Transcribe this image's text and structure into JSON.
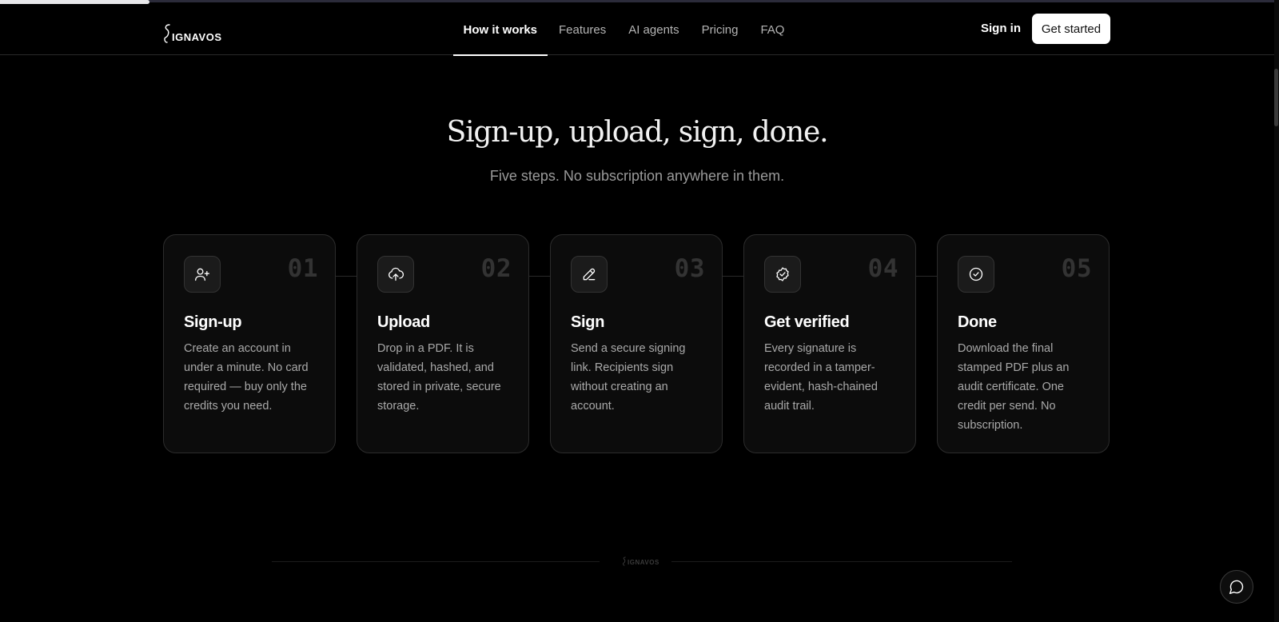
{
  "brand": {
    "name": "IGNAVOS",
    "footer_name": "IGNAVOS"
  },
  "nav": {
    "items": [
      {
        "label": "How it works",
        "active": true
      },
      {
        "label": "Features",
        "active": false
      },
      {
        "label": "AI agents",
        "active": false
      },
      {
        "label": "Pricing",
        "active": false
      },
      {
        "label": "FAQ",
        "active": false
      }
    ],
    "sign_in": "Sign in",
    "get_started": "Get started"
  },
  "hero": {
    "title": "Sign-up, upload, sign, done.",
    "subtitle": "Five steps. No subscription anywhere in them."
  },
  "steps": [
    {
      "number": "01",
      "title": "Sign-up",
      "icon": "user-plus-icon",
      "description": "Create an account in under a minute. No card required — buy only the credits you need."
    },
    {
      "number": "02",
      "title": "Upload",
      "icon": "cloud-upload-icon",
      "description": "Drop in a PDF. It is validated, hashed, and stored in private, secure storage."
    },
    {
      "number": "03",
      "title": "Sign",
      "icon": "pen-icon",
      "description": "Send a secure signing link. Recipients sign without creating an account."
    },
    {
      "number": "04",
      "title": "Get verified",
      "icon": "badge-check-icon",
      "description": "Every signature is recorded in a tamper-evident, hash-chained audit trail."
    },
    {
      "number": "05",
      "title": "Done",
      "icon": "circle-check-icon",
      "description": "Download the final stamped PDF plus an audit certificate. One credit per send. No subscription."
    }
  ],
  "chat": {
    "icon": "chat-bubble-icon"
  },
  "colors": {
    "background": "#000000",
    "card": "#0c0c0c",
    "accent": "#ffffff",
    "muted_text": "#a9a9a9"
  }
}
